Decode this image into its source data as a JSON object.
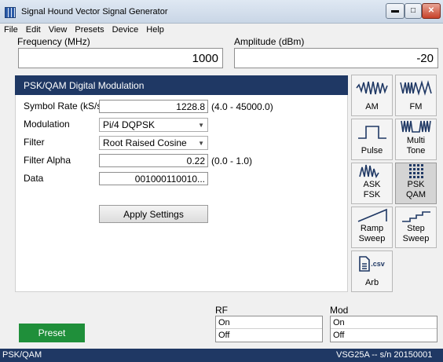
{
  "window": {
    "title": "Signal Hound Vector Signal Generator"
  },
  "menu": [
    "File",
    "Edit",
    "View",
    "Presets",
    "Device",
    "Help"
  ],
  "frequency": {
    "label": "Frequency (MHz)",
    "value": "1000"
  },
  "amplitude": {
    "label": "Amplitude (dBm)",
    "value": "-20"
  },
  "panel": {
    "title": "PSK/QAM Digital Modulation",
    "symbol_rate": {
      "label": "Symbol Rate (kS/s)",
      "value": "1228.8",
      "range": "(4.0 - 45000.0)"
    },
    "modulation": {
      "label": "Modulation",
      "value": "Pi/4 DQPSK"
    },
    "filter": {
      "label": "Filter",
      "value": "Root Raised Cosine"
    },
    "filter_alpha": {
      "label": "Filter Alpha",
      "value": "0.22",
      "range": "(0.0 - 1.0)"
    },
    "data": {
      "label": "Data",
      "value": "001000110010..."
    },
    "apply_label": "Apply Settings"
  },
  "modes": [
    {
      "key": "am",
      "label": "AM",
      "icon": "am-wave-icon"
    },
    {
      "key": "fm",
      "label": "FM",
      "icon": "fm-wave-icon"
    },
    {
      "key": "pulse",
      "label": "Pulse",
      "icon": "pulse-icon"
    },
    {
      "key": "multitone",
      "label": "Multi\nTone",
      "icon": "multitone-icon"
    },
    {
      "key": "askfsk",
      "label": "ASK\nFSK",
      "icon": "ask-fsk-icon"
    },
    {
      "key": "pskqam",
      "label": "PSK\nQAM",
      "icon": "constellation-icon",
      "active": true
    },
    {
      "key": "ramp",
      "label": "Ramp\nSweep",
      "icon": "ramp-icon"
    },
    {
      "key": "step",
      "label": "Step\nSweep",
      "icon": "step-icon"
    },
    {
      "key": "arb",
      "label": "Arb",
      "icon": "csv-file-icon",
      "icon_text": ".csv"
    }
  ],
  "rf": {
    "label": "RF",
    "on": "On",
    "off": "Off"
  },
  "mod": {
    "label": "Mod",
    "on": "On",
    "off": "Off"
  },
  "preset_label": "Preset",
  "status": {
    "left": "PSK/QAM",
    "right": "VSG25A -- s/n 20150001"
  },
  "colors": {
    "header": "#1f3864",
    "preset": "#1f8f3a",
    "icon": "#1f3864"
  }
}
